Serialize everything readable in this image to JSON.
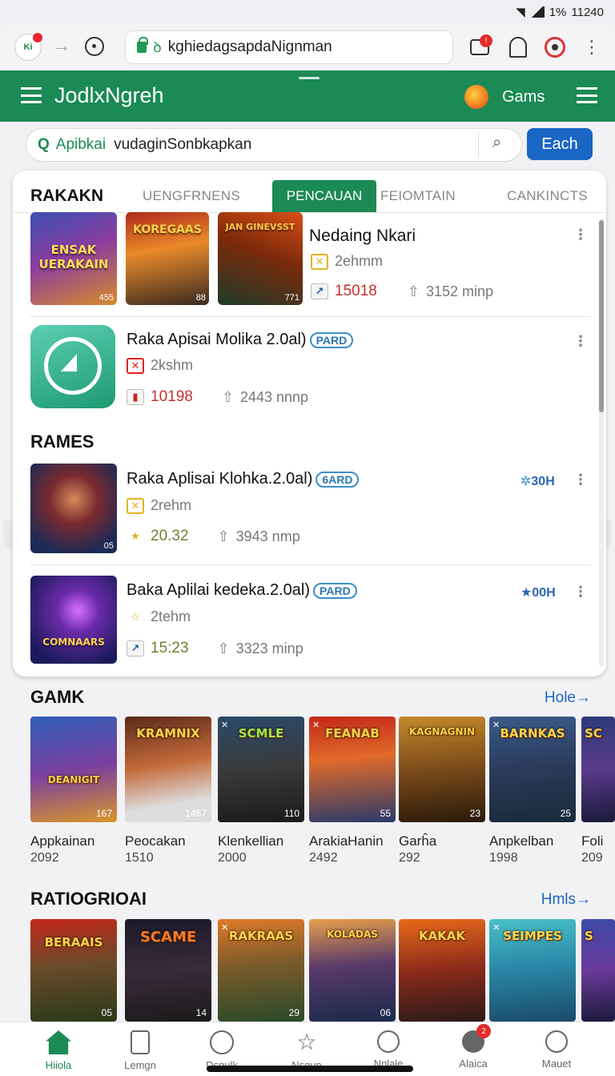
{
  "status": {
    "battery": "1%",
    "time": "11240"
  },
  "browser": {
    "favicon_text": "Ki",
    "url": "kghiedagsapdaNignman",
    "url_icon": "ꝺ"
  },
  "app": {
    "title": "JodlxNgreh",
    "games_label": "Gams"
  },
  "search": {
    "prefix": "Apibkai",
    "query": "vudaginSonbkapkan",
    "button": "Each"
  },
  "tabs": {
    "main": "RAKAKN",
    "items": [
      "UENGFRNENS",
      "PENCAUAN",
      "FEIOMTAIN",
      "CANKINCTS"
    ]
  },
  "featured": {
    "thumbs": [
      {
        "label": "ENSAK UERAKAIN",
        "num": "455"
      },
      {
        "label": "KOREGAAS",
        "num": "88"
      },
      {
        "label": "JAN GINEVSST",
        "num": "771"
      }
    ],
    "title": "Nedaing Nkari",
    "size": "2ehmm",
    "count": "15018",
    "downloads": "3152 minp"
  },
  "list": [
    {
      "title": "Raka Apisai Molika 2.0al)",
      "pill": "PARD",
      "size": "2kshm",
      "count": "10198",
      "downloads": "2443 nnnp"
    }
  ],
  "rames": {
    "title": "RAMES",
    "items": [
      {
        "title": "Raka Aplisai Klohka.2.0al)",
        "pill": "6ARD",
        "size": "2rehm",
        "count": "20.32",
        "downloads": "3943 nmp",
        "rating": "30H",
        "thumb_num": "05"
      },
      {
        "title": "Baka Aplilai kedeka.2.0al)",
        "pill": "PARD",
        "size": "2tehm",
        "count": "15:23",
        "downloads": "3323 minp",
        "rating": "00H",
        "thumb_label": "COMNAARS"
      }
    ]
  },
  "gamk": {
    "title": "GAMK",
    "more": "Hole→",
    "items": [
      {
        "cover": "DEANIGIT",
        "name": "Appkainan",
        "num": "2092",
        "cnum": "167"
      },
      {
        "cover": "KRAMNIX",
        "name": "Peocakan",
        "num": "1510",
        "cnum": "1467"
      },
      {
        "cover": "SCMLE",
        "name": "Klenkellian",
        "num": "2000",
        "cnum": "110"
      },
      {
        "cover": "FEANAB",
        "name": "ArakiaHanin",
        "num": "2492",
        "cnum": "55"
      },
      {
        "cover": "KAGNAGNIN",
        "name": "Garĥa",
        "num": "292",
        "cnum": "23"
      },
      {
        "cover": "BARNKAS",
        "name": "Anpkelban",
        "num": "1998",
        "cnum": "25"
      },
      {
        "cover": "SC",
        "name": "Foli",
        "num": "209",
        "cnum": ""
      }
    ]
  },
  "ratiogrioai": {
    "title": "RATIOGRIOAI",
    "more": "Hmls→",
    "items": [
      {
        "cover": "BERAAIS",
        "cnum": "05"
      },
      {
        "cover": "SCAME",
        "cnum": "14"
      },
      {
        "cover": "RAKRAAS",
        "cnum": "29"
      },
      {
        "cover": "KOLADAS",
        "cnum": "06"
      },
      {
        "cover": "KAKAK",
        "cnum": ""
      },
      {
        "cover": "SEIMPES",
        "cnum": ""
      },
      {
        "cover": "S",
        "cnum": ""
      }
    ]
  },
  "bottom_nav": [
    "Hiiola",
    "Lemgn",
    "Dsqulk",
    "Nsqun",
    "Nnlale",
    "Alaica",
    "Mauet"
  ],
  "colors": {
    "brand_green": "#1b8a55",
    "accent_blue": "#1a66c4",
    "badge_red": "#e52a2a"
  }
}
